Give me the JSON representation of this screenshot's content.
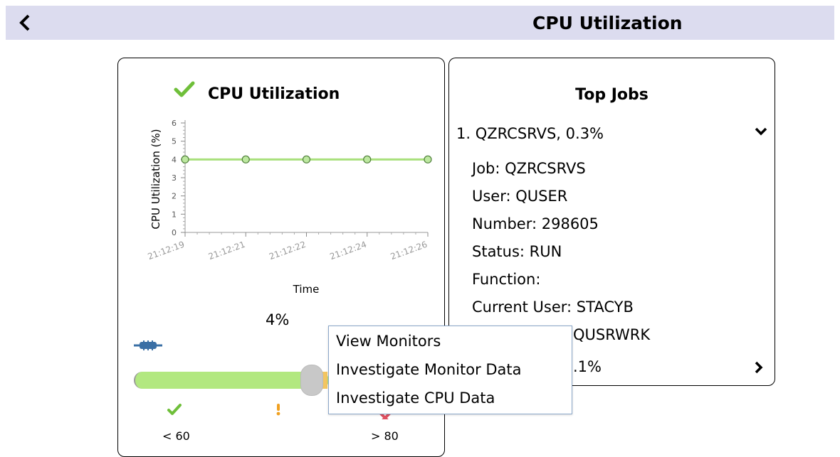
{
  "header": {
    "title": "CPU Utilization",
    "back_icon": "chevron-left-icon"
  },
  "cpu_card": {
    "title": "CPU Utilization",
    "status_icon": "check-icon",
    "percent": "4%",
    "threshold_low": "< 60",
    "threshold_high": "> 80"
  },
  "chart_data": {
    "type": "line",
    "xlabel": "Time",
    "ylabel": "CPU Utilization (%)",
    "x": [
      "21:12:19",
      "21:12:21",
      "21:12:22",
      "21:12:24",
      "21:12:26"
    ],
    "series": [
      {
        "values": [
          4,
          4,
          4,
          4,
          4
        ]
      }
    ],
    "ylim": [
      0,
      6
    ],
    "y_ticks": [
      0,
      1,
      2,
      3,
      4,
      5,
      6
    ],
    "grid": false,
    "colors": {
      "line": "#a8e07c",
      "marker": "#bde8a0",
      "marker_edge": "#4f7f3a"
    }
  },
  "gauge": {
    "value_percent": 4,
    "accent_ok": "#b2e880",
    "accent_warn": "#f3c560"
  },
  "top_jobs": {
    "title": "Top Jobs",
    "item1_header": "1. QZRCSRVS, 0.3%",
    "details": [
      "Job: QZRCSRVS",
      "User: QUSER",
      "Number: 298605",
      "Status: RUN",
      "Function:",
      "Current User: STACYB",
      "QUSRWRK",
      ".1%"
    ]
  },
  "context_menu": {
    "items": [
      "View Monitors",
      "Investigate Monitor Data",
      "Investigate CPU Data"
    ]
  }
}
